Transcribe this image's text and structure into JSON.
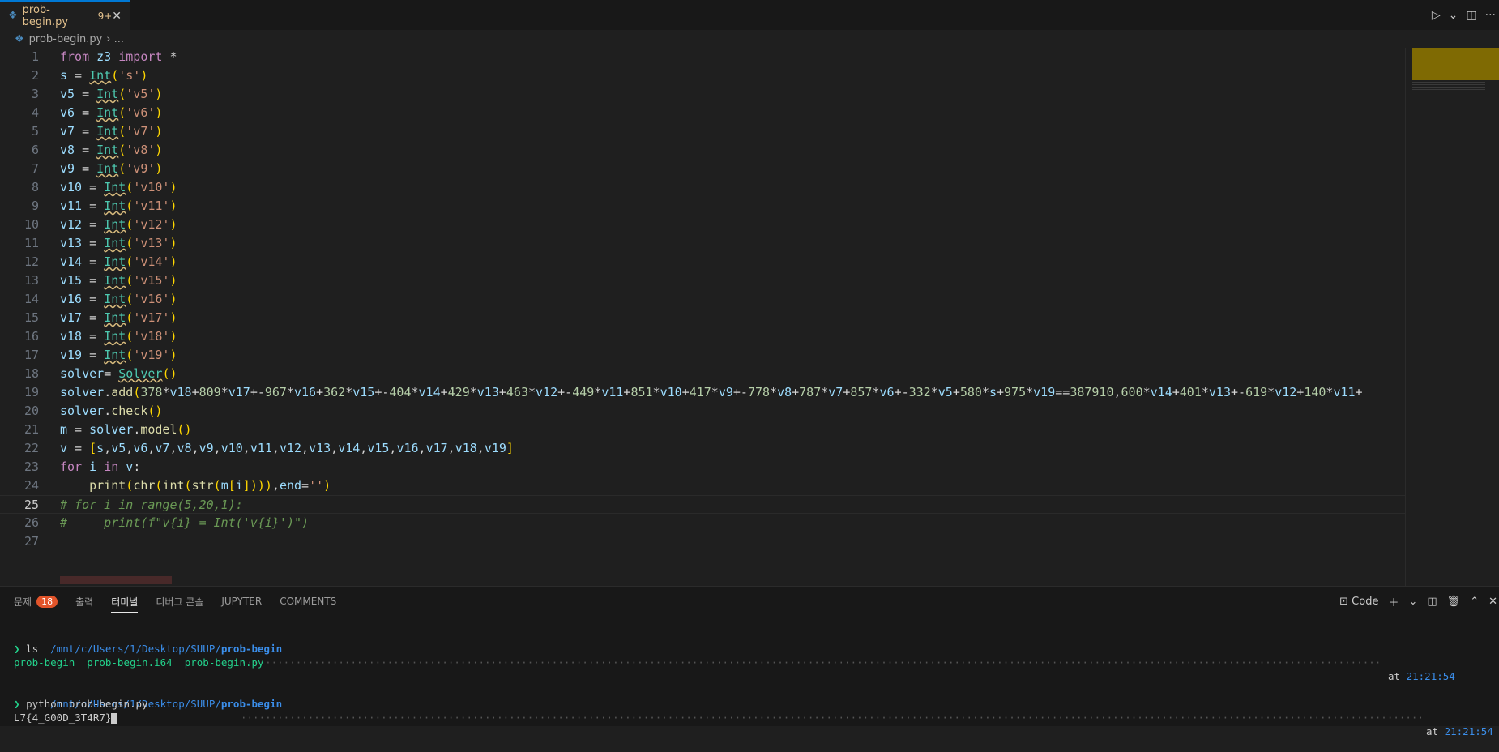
{
  "tab": {
    "icon": "python-file-icon",
    "filename": "prob-begin.py",
    "badge": "9+"
  },
  "breadcrumb": {
    "file": "prob-begin.py",
    "sep": "› ..."
  },
  "editor": {
    "line_numbers": [
      "1",
      "2",
      "3",
      "4",
      "5",
      "6",
      "7",
      "8",
      "9",
      "10",
      "11",
      "12",
      "13",
      "14",
      "15",
      "16",
      "17",
      "18",
      "19",
      "20",
      "21",
      "22",
      "23",
      "24",
      "25",
      "26",
      "27"
    ],
    "lines": [
      "from z3 import *",
      "s = Int('s')",
      "v5 = Int('v5')",
      "v6 = Int('v6')",
      "v7 = Int('v7')",
      "v8 = Int('v8')",
      "v9 = Int('v9')",
      "v10 = Int('v10')",
      "v11 = Int('v11')",
      "v12 = Int('v12')",
      "v13 = Int('v13')",
      "v14 = Int('v14')",
      "v15 = Int('v15')",
      "v16 = Int('v16')",
      "v17 = Int('v17')",
      "v18 = Int('v18')",
      "v19 = Int('v19')",
      "solver= Solver()",
      "solver.add(378*v18+809*v17+-967*v16+362*v15+-404*v14+429*v13+463*v12+-449*v11+851*v10+417*v9+-778*v8+787*v7+857*v6+-332*v5+580*s+975*v19==387910,600*v14+401*v13+-619*v12+140*v11+",
      "solver.check()",
      "m = solver.model()",
      "v = [s,v5,v6,v7,v8,v9,v10,v11,v12,v13,v14,v15,v16,v17,v18,v19]",
      "for i in v:",
      "    print(chr(int(str(m[i]))),end='')",
      "# for i in range(5,20,1):",
      "#     print(f\"v{i} = Int('v{i}')\")",
      ""
    ]
  },
  "panel": {
    "tabs": [
      "문제",
      "출력",
      "터미널",
      "디버그 콘솔",
      "JUPYTER",
      "COMMENTS"
    ],
    "problems_count": "18",
    "terminal_profile": "Code",
    "terminal": {
      "path_prefix": "/mnt/c/Users/1/Desktop/SUUP/",
      "path_dir": "prob-begin",
      "dots": "·························································································································································································································································",
      "at_label": "at",
      "time1": "21:21:54",
      "time2": "21:21:54",
      "cmd1": "ls",
      "ls_out": "prob-begin  prob-begin.i64  prob-begin.py",
      "cmd2": "python prob-begin.py",
      "output": "L7{4_G00D_3T4R7}"
    }
  },
  "colors": {
    "accent": "#0078d4",
    "badge": "#e2542a",
    "prompt": "#23d18b",
    "path": "#3b8eea"
  }
}
